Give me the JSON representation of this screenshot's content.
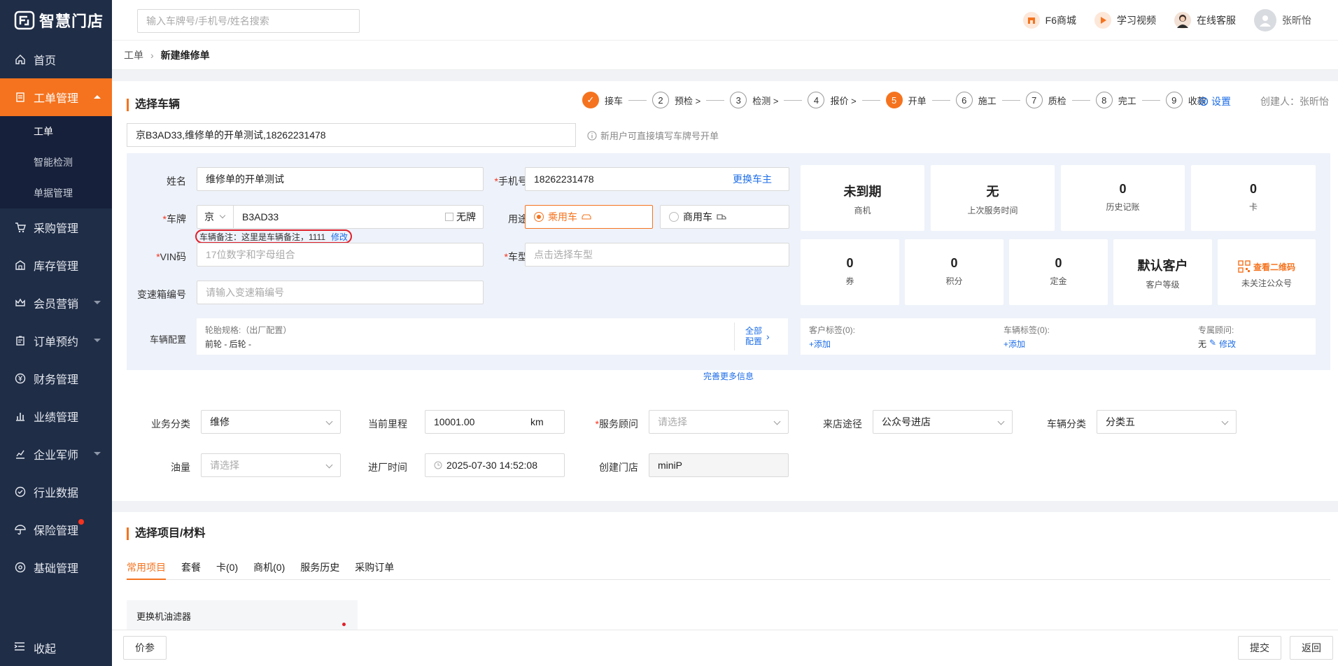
{
  "app": {
    "title": "智慧门店"
  },
  "sidebar": {
    "items": [
      {
        "label": "首页",
        "icon": "home-icon"
      },
      {
        "label": "工单管理",
        "icon": "document-icon"
      },
      {
        "label": "采购管理",
        "icon": "cart-icon"
      },
      {
        "label": "库存管理",
        "icon": "warehouse-icon"
      },
      {
        "label": "会员营销",
        "icon": "crown-icon"
      },
      {
        "label": "订单预约",
        "icon": "clipboard-icon"
      },
      {
        "label": "财务管理",
        "icon": "yen-icon"
      },
      {
        "label": "业绩管理",
        "icon": "bar-chart-icon"
      },
      {
        "label": "企业军师",
        "icon": "trend-icon"
      },
      {
        "label": "行业数据",
        "icon": "gauge-icon"
      },
      {
        "label": "保险管理",
        "icon": "umbrella-icon"
      },
      {
        "label": "基础管理",
        "icon": "gear-icon"
      }
    ],
    "sub_items": [
      "工单",
      "智能检测",
      "单据管理"
    ],
    "collapse_label": "收起"
  },
  "topbar": {
    "search_placeholder": "输入车牌号/手机号/姓名搜索",
    "mall": "F6商城",
    "video": "学习视频",
    "service": "在线客服",
    "user": "张昕怡"
  },
  "breadcrumb": {
    "parent": "工单",
    "current": "新建维修单"
  },
  "vehicle": {
    "section_title": "选择车辆",
    "steps": [
      {
        "n": "1",
        "label": "接车",
        "done": true
      },
      {
        "n": "2",
        "label": "预检 >"
      },
      {
        "n": "3",
        "label": "检测 >"
      },
      {
        "n": "4",
        "label": "报价 >"
      },
      {
        "n": "5",
        "label": "开单",
        "current": true
      },
      {
        "n": "6",
        "label": "施工"
      },
      {
        "n": "7",
        "label": "质检"
      },
      {
        "n": "8",
        "label": "完工"
      },
      {
        "n": "9",
        "label": "收款"
      }
    ],
    "settings_label": "设置",
    "creator": "创建人：张昕怡",
    "search_value": "京B3AD33,维修单的开单测试,18262231478",
    "hint": "新用户可直接填写车牌号开单",
    "name_label": "姓名",
    "name_value": "维修单的开单测试",
    "phone_label": "手机号",
    "phone_value": "18262231478",
    "change_owner": "更换车主",
    "plate_label": "车牌",
    "plate_prefix": "京",
    "plate_value": "B3AD33",
    "no_plate": "无牌",
    "usage_label": "用途",
    "usage_passenger": "乘用车",
    "usage_commercial": "商用车",
    "plate_note": "车辆备注：这里是车辆备注，1111",
    "plate_note_edit": "修改",
    "vin_label": "VIN码",
    "vin_placeholder": "17位数字和字母组合",
    "model_label": "车型",
    "model_placeholder": "点击选择车型",
    "gearbox_label": "变速箱编号",
    "gearbox_placeholder": "请输入变速箱编号",
    "config_label": "车辆配置",
    "tire_spec": "轮胎规格:（出厂配置）",
    "tire_value": "前轮 - 后轮 -",
    "all_config": "全部配置",
    "customer_tags": "客户标签(0):",
    "vehicle_tags": "车辆标签(0):",
    "advisor": "专属顾问:",
    "add": "+添加",
    "advisor_value": "无",
    "advisor_edit": "修改",
    "more_info": "完善更多信息",
    "stats_top": [
      {
        "value": "未到期",
        "label": "商机"
      },
      {
        "value": "无",
        "label": "上次服务时间"
      },
      {
        "value": "0",
        "label": "历史记账"
      },
      {
        "value": "0",
        "label": "卡"
      }
    ],
    "stats_bottom": [
      {
        "value": "0",
        "label": "券"
      },
      {
        "value": "0",
        "label": "积分"
      },
      {
        "value": "0",
        "label": "定金"
      },
      {
        "value": "默认客户",
        "label": "客户等级"
      }
    ],
    "qr_label": "查看二维码",
    "qr_sub": "未关注公众号"
  },
  "order_form": {
    "business_label": "业务分类",
    "business_value": "维修",
    "mileage_label": "当前里程",
    "mileage_value": "10001.00",
    "mileage_unit": "km",
    "advisor_label": "服务顾问",
    "advisor_placeholder": "请选择",
    "source_label": "来店途径",
    "source_value": "公众号进店",
    "category_label": "车辆分类",
    "category_value": "分类五",
    "fuel_label": "油量",
    "fuel_placeholder": "请选择",
    "entry_label": "进厂时间",
    "entry_value": "2025-07-30 14:52:08",
    "store_label": "创建门店",
    "store_value": "miniP"
  },
  "items": {
    "section_title": "选择项目/材料",
    "tabs": [
      "常用项目",
      "套餐",
      "卡(0)",
      "商机(0)",
      "服务历史",
      "采购订单"
    ],
    "first_item": "更换机油滤器"
  },
  "footer": {
    "price_ref": "价参",
    "submit": "提交",
    "back": "返回"
  },
  "colors": {
    "accent": "#f5731e",
    "sidebar": "#1f2d47",
    "link": "#1e6ee8",
    "highlight": "#e0202a"
  }
}
